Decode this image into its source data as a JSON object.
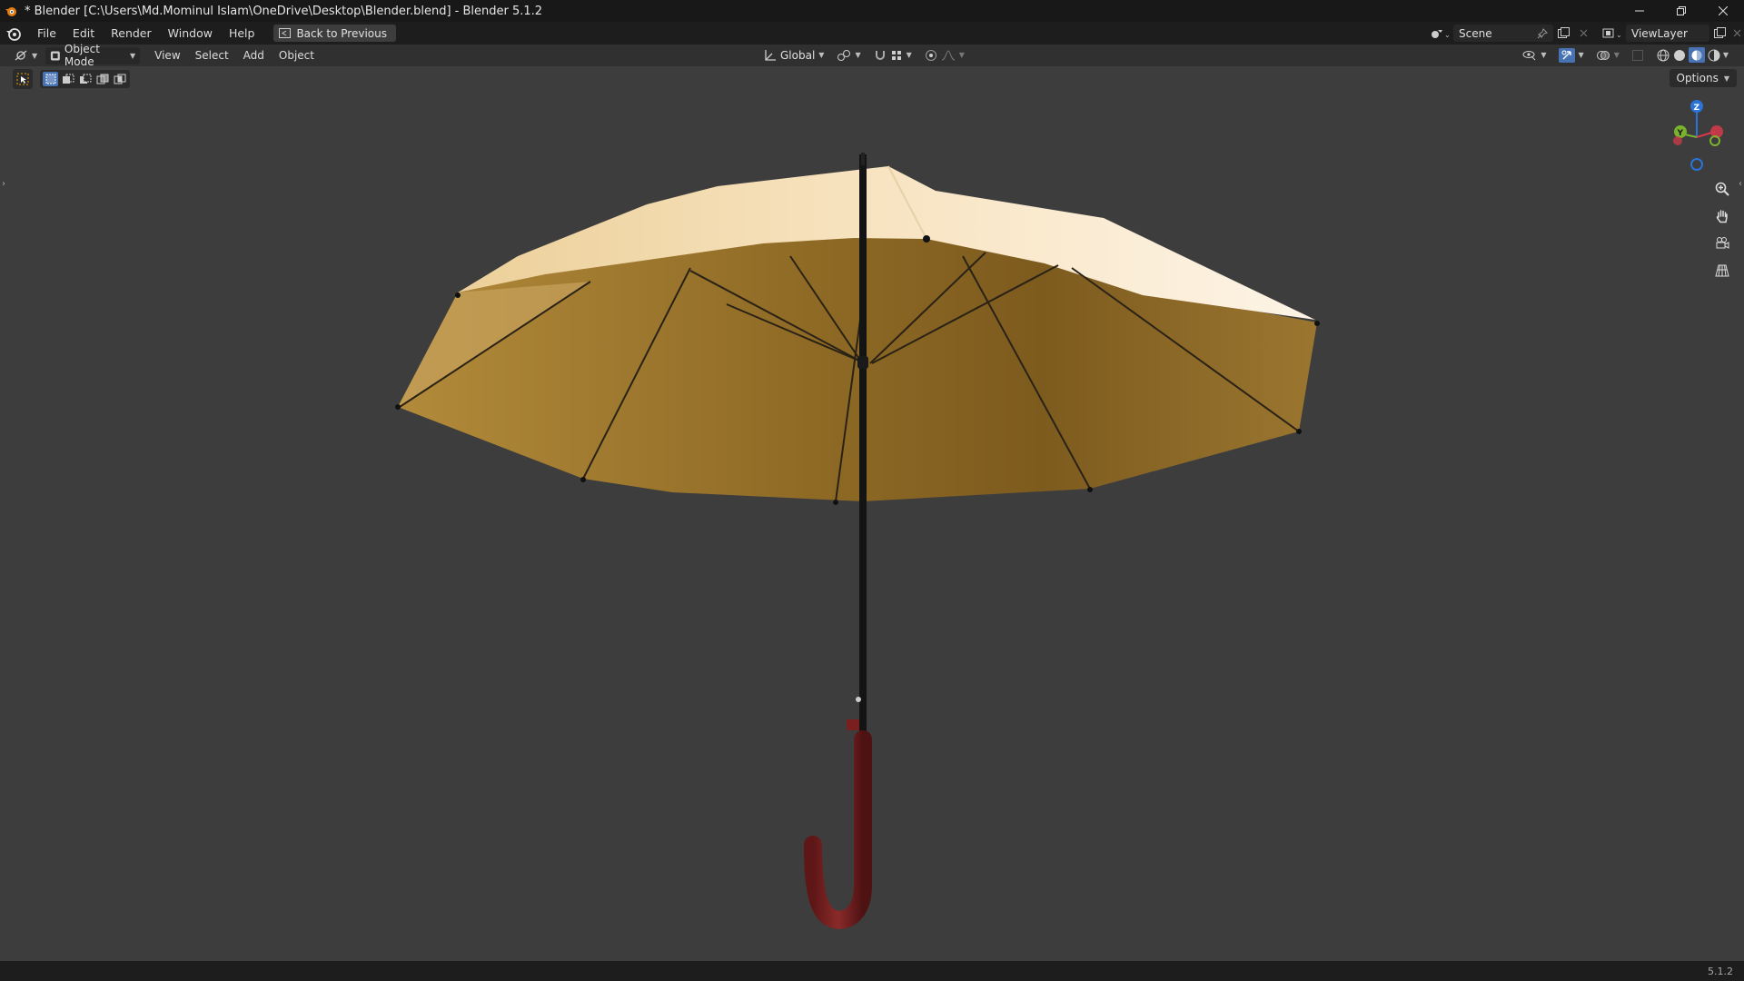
{
  "window": {
    "title": "* Blender [C:\\Users\\Md.Mominul Islam\\OneDrive\\Desktop\\Blender.blend] - Blender 5.1.2"
  },
  "menubar": {
    "items": [
      "File",
      "Edit",
      "Render",
      "Window",
      "Help"
    ],
    "back_label": "Back to Previous",
    "scene_name": "Scene",
    "view_layer": "ViewLayer"
  },
  "viewport_header": {
    "mode": "Object Mode",
    "menus": [
      "View",
      "Select",
      "Add",
      "Object"
    ],
    "transform_orientation": "Global"
  },
  "toolbar": {
    "options_label": "Options"
  },
  "gizmo": {
    "z_label": "Z",
    "y_label": "Y"
  },
  "status": {
    "version": "5.1.2"
  },
  "colors": {
    "accent": "#4772b3",
    "canopy_inner": "#a2782e",
    "canopy_outer": "#f6e6c4",
    "handle": "#6e1d1d",
    "axis_x": "#d63a4a",
    "axis_y": "#7ab22e",
    "axis_z": "#2b73d6"
  }
}
